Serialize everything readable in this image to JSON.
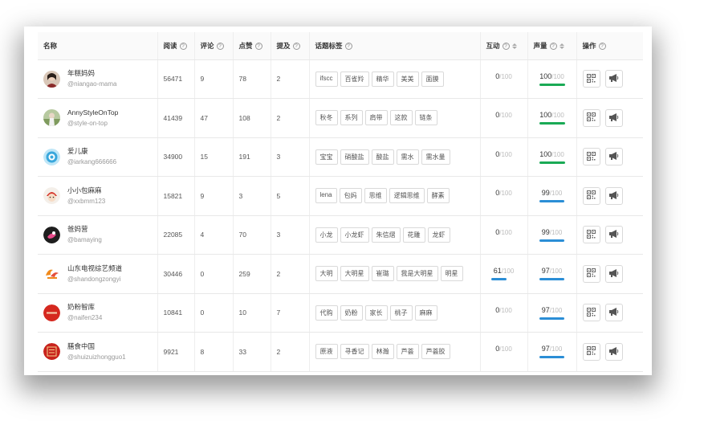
{
  "headers": {
    "name": "名称",
    "reads": "阅读",
    "comments": "评论",
    "likes": "点赞",
    "mentions": "提及",
    "topics": "话题标签",
    "interaction": "互动",
    "voice": "声量",
    "actions": "操作",
    "help_glyph": "?"
  },
  "max_label": "/100",
  "colors": {
    "green": "#1aaa55",
    "blue": "#2b8ed6"
  },
  "rows": [
    {
      "nick": "年糕妈妈",
      "handle": "@niangao-mama",
      "reads": "56471",
      "comments": "9",
      "likes": "78",
      "mentions": "2",
      "tags": [
        "ifscc",
        "百雀羚",
        "精华",
        "美美",
        "面膜"
      ],
      "interaction": "0",
      "interaction_pct": 0,
      "voice": "100",
      "voice_pct": 100,
      "voice_color": "green",
      "avatar": "photo-woman"
    },
    {
      "nick": "AnnyStyleOnTop",
      "handle": "@style-on-top",
      "reads": "41439",
      "comments": "47",
      "likes": "108",
      "mentions": "2",
      "tags": [
        "秋冬",
        "系列",
        "肩带",
        "这款",
        "链条"
      ],
      "interaction": "0",
      "interaction_pct": 0,
      "voice": "100",
      "voice_pct": 100,
      "voice_color": "green",
      "avatar": "photo-outdoor"
    },
    {
      "nick": "爱儿康",
      "handle": "@iarkang666666",
      "reads": "34900",
      "comments": "15",
      "likes": "191",
      "mentions": "3",
      "tags": [
        "宝宝",
        "硝酸盐",
        "酸盐",
        "需水",
        "需水量"
      ],
      "interaction": "0",
      "interaction_pct": 0,
      "voice": "100",
      "voice_pct": 100,
      "voice_color": "green",
      "avatar": "logo-blue"
    },
    {
      "nick": "小小包麻麻",
      "handle": "@xxbmm123",
      "reads": "15821",
      "comments": "9",
      "likes": "3",
      "mentions": "5",
      "tags": [
        "lena",
        "包妈",
        "思维",
        "逻辑思维",
        "酵素"
      ],
      "interaction": "0",
      "interaction_pct": 0,
      "voice": "99",
      "voice_pct": 99,
      "voice_color": "blue",
      "avatar": "cartoon-red"
    },
    {
      "nick": "爸妈营",
      "handle": "@bamaying",
      "reads": "22085",
      "comments": "4",
      "likes": "70",
      "mentions": "3",
      "tags": [
        "小龙",
        "小龙虾",
        "朱信熠",
        "花雕",
        "龙虾"
      ],
      "interaction": "0",
      "interaction_pct": 0,
      "voice": "99",
      "voice_pct": 99,
      "voice_color": "blue",
      "avatar": "logo-dark"
    },
    {
      "nick": "山东电视综艺频道",
      "handle": "@shandongzongyi",
      "reads": "30446",
      "comments": "0",
      "likes": "259",
      "mentions": "2",
      "tags": [
        "大明",
        "大明星",
        "崔璐",
        "我是大明星",
        "明星"
      ],
      "interaction": "61",
      "interaction_pct": 61,
      "voice": "97",
      "voice_pct": 97,
      "voice_color": "blue",
      "avatar": "logo-orange"
    },
    {
      "nick": "奶粉智库",
      "handle": "@naifen234",
      "reads": "10841",
      "comments": "0",
      "likes": "10",
      "mentions": "7",
      "tags": [
        "代购",
        "奶粉",
        "家长",
        "桃子",
        "麻麻"
      ],
      "interaction": "0",
      "interaction_pct": 0,
      "voice": "97",
      "voice_pct": 97,
      "voice_color": "blue",
      "avatar": "logo-red"
    },
    {
      "nick": "膳食中国",
      "handle": "@shuizuizhongguo1",
      "reads": "9921",
      "comments": "8",
      "likes": "33",
      "mentions": "2",
      "tags": [
        "原液",
        "寻香记",
        "林瀚",
        "芦荟",
        "芦荟胶"
      ],
      "interaction": "0",
      "interaction_pct": 0,
      "voice": "97",
      "voice_pct": 97,
      "voice_color": "blue",
      "avatar": "seal-red"
    }
  ]
}
